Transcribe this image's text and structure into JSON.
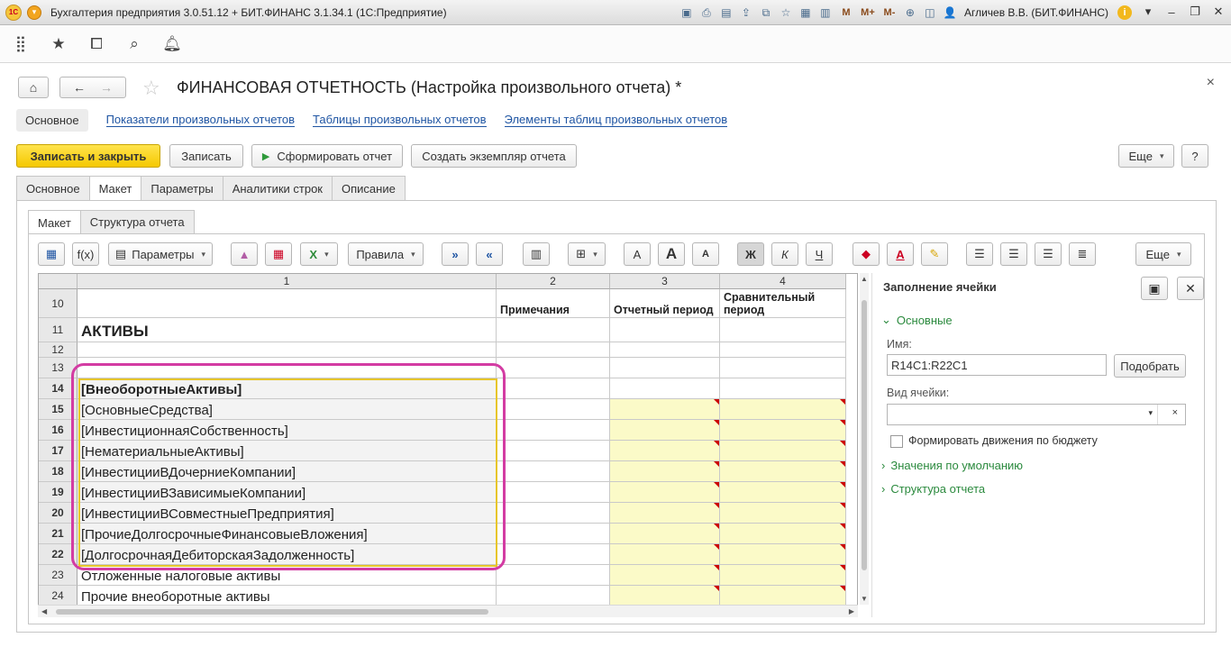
{
  "window": {
    "title": "Бухгалтерия предприятия 3.0.51.12 + БИТ.ФИНАНС 3.1.34.1  (1С:Предприятие)",
    "user": "Агличев В.В. (БИТ.ФИНАНС)",
    "memory_buttons": [
      "M",
      "M+",
      "M-"
    ]
  },
  "form": {
    "title": "ФИНАНСОВАЯ ОТЧЕТНОСТЬ (Настройка произвольного отчета) *",
    "sections": {
      "current": "Основное",
      "links": [
        "Показатели произвольных отчетов",
        "Таблицы произвольных отчетов",
        "Элементы таблиц произвольных отчетов"
      ]
    },
    "commands": {
      "save_close": "Записать и закрыть",
      "save": "Записать",
      "generate": "Сформировать отчет",
      "create_instance": "Создать экземпляр отчета",
      "more": "Еще",
      "help": "?"
    },
    "tabs": [
      "Основное",
      "Макет",
      "Параметры",
      "Аналитики строк",
      "Описание"
    ],
    "subtabs": [
      "Макет",
      "Структура отчета"
    ]
  },
  "toolbar": {
    "params": "Параметры",
    "rules": "Правила",
    "more": "Еще",
    "fx": "f(x)",
    "font_bigger": "A",
    "font_smaller": "A",
    "bold": "Ж",
    "italic": "К",
    "underline": "Ч"
  },
  "sheet": {
    "columns": [
      "1",
      "2",
      "3",
      "4"
    ],
    "header_row": {
      "num": "10",
      "c2": "Примечания",
      "c3": "Отчетный период",
      "c4": "Сравнительный период"
    },
    "rows": [
      {
        "num": "11",
        "text": "АКТИВЫ"
      },
      {
        "num": "12",
        "text": ""
      },
      {
        "num": "13",
        "text": ""
      },
      {
        "num": "14",
        "text": "[ВнеоборотныеАктивы]"
      },
      {
        "num": "15",
        "text": "[ОсновныеСредства]"
      },
      {
        "num": "16",
        "text": "[ИнвестиционнаяСобственность]"
      },
      {
        "num": "17",
        "text": "[НематериальныеАктивы]"
      },
      {
        "num": "18",
        "text": "[ИнвестицииВДочерниеКомпании]"
      },
      {
        "num": "19",
        "text": "[ИнвестицииВЗависимыеКомпании]"
      },
      {
        "num": "20",
        "text": "[ИнвестицииВСовместныеПредприятия]"
      },
      {
        "num": "21",
        "text": "[ПрочиеДолгосрочныеФинансовыеВложения]"
      },
      {
        "num": "22",
        "text": "[ДолгосрочнаяДебиторскаяЗадолженность]"
      },
      {
        "num": "23",
        "text": "Отложенные налоговые активы"
      },
      {
        "num": "24",
        "text": "Прочие внеоборотные активы"
      }
    ]
  },
  "side_panel": {
    "title": "Заполнение ячейки",
    "group_main": "Основные",
    "name_label": "Имя:",
    "name_value": "R14C1:R22C1",
    "pick_button": "Подобрать",
    "cell_type_label": "Вид ячейки:",
    "cell_type_value": "",
    "budget_checkbox": "Формировать движения по бюджету",
    "group_defaults": "Значения по умолчанию",
    "group_structure": "Структура отчета"
  },
  "colors": {
    "accent_yellow": "#f5c800",
    "green_link": "#2b8a3e",
    "blue_link": "#1f55a3",
    "highlight": "#d33ca3"
  }
}
